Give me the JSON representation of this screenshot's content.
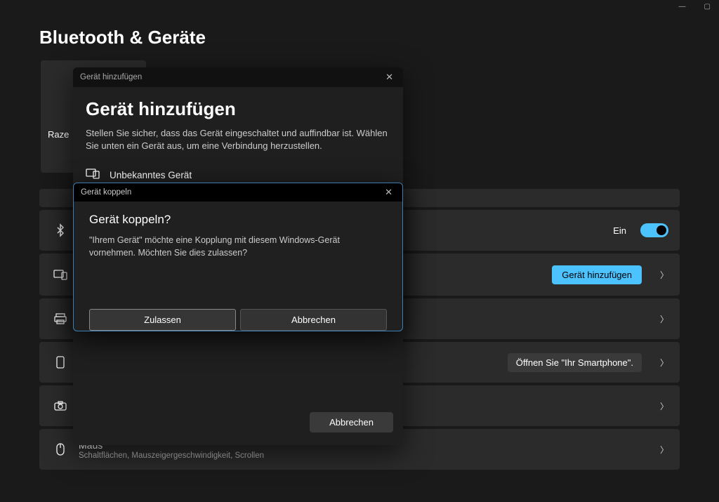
{
  "titlebar": {
    "minimize": "—",
    "maximize": "▢"
  },
  "page": {
    "title": "Bluetooth & Geräte"
  },
  "bg_card": {
    "name_partial": "Raze"
  },
  "rows": {
    "bluetooth": {
      "title": "",
      "toggle_label": "Ein"
    },
    "devices": {
      "title": "",
      "add_button": "Gerät hinzufügen"
    },
    "printers": {
      "title": ""
    },
    "phone": {
      "title": "",
      "action": "Öffnen Sie \"Ihr Smartphone\"."
    },
    "camera": {
      "title": ""
    },
    "mouse": {
      "title": "Maus",
      "sub": "Schaltflächen, Mauszeigergeschwindigkeit, Scrollen"
    }
  },
  "dialog_add": {
    "window_title": "Gerät hinzufügen",
    "title": "Gerät hinzufügen",
    "description": "Stellen Sie sicher, dass das Gerät eingeschaltet und auffindbar ist. Wählen Sie unten ein Gerät aus, um eine Verbindung herzustellen.",
    "device_label": "Unbekanntes Gerät",
    "cancel": "Abbrechen"
  },
  "dialog_pair": {
    "window_title": "Gerät koppeln",
    "title": "Gerät koppeln?",
    "message": "\"Ihrem Gerät\" möchte eine Kopplung mit diesem Windows-Gerät vornehmen. Möchten Sie dies zulassen?",
    "allow": "Zulassen",
    "cancel": "Abbrechen"
  }
}
